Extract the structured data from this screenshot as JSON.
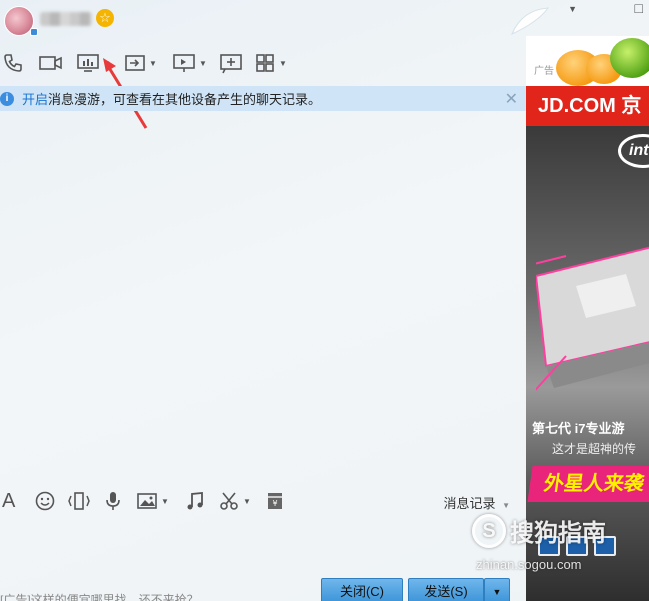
{
  "title_bar": {
    "vip_star": "☆",
    "window_controls": {
      "minimize": "▼",
      "maximize": "□"
    }
  },
  "toolbar": {
    "icons": [
      "phone-icon",
      "video-icon",
      "screen-share-icon",
      "file-transfer-icon",
      "remote-desktop-icon",
      "share-screen-icon",
      "apps-icon"
    ]
  },
  "notice": {
    "link_text": "开启",
    "text": "消息漫游，可查看在其他设备产生的聊天记录。",
    "close": "✕"
  },
  "input_toolbar": {
    "font_icon": "A",
    "icons": [
      "font-icon",
      "emoji-icon",
      "shake-icon",
      "voice-icon",
      "image-icon",
      "music-icon",
      "screenshot-icon",
      "gift-icon"
    ],
    "history_label": "消息记录"
  },
  "footer": {
    "ad_text": "[广告]这样的便宜哪里找，还不来抢？",
    "close_button": "关闭(C)",
    "send_button": "发送(S)",
    "send_menu": "▼"
  },
  "ad": {
    "top_label": "广告",
    "brand": "JD.COM 京",
    "intel": "int",
    "headline": "第七代 i7专业游",
    "sub": "这才是超神的传",
    "cta": "外星人来袭"
  },
  "watermark": {
    "logo": "S",
    "text": "搜狗指南",
    "url": "zhinan.sogou.com"
  },
  "colors": {
    "accent": "#3b94d9",
    "notice_bg": "#cfe4f6",
    "jd_red": "#e1251b",
    "annotation_arrow": "#e83a3a"
  }
}
